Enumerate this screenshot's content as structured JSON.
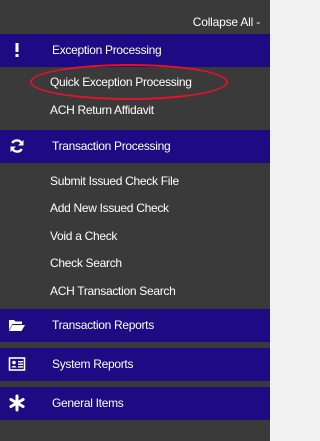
{
  "header": {
    "collapse_label": "Collapse All -"
  },
  "sections": [
    {
      "label": "Exception Processing",
      "icon": "exclamation-icon",
      "items": [
        {
          "label": "Quick Exception Processing"
        },
        {
          "label": "ACH Return Affidavit"
        }
      ]
    },
    {
      "label": "Transaction Processing",
      "icon": "refresh-icon",
      "items": [
        {
          "label": "Submit Issued Check File"
        },
        {
          "label": "Add New Issued Check"
        },
        {
          "label": "Void a Check"
        },
        {
          "label": "Check Search"
        },
        {
          "label": "ACH Transaction Search"
        }
      ]
    },
    {
      "label": "Transaction Reports",
      "icon": "folder-open-icon",
      "items": []
    },
    {
      "label": "System Reports",
      "icon": "id-card-icon",
      "items": []
    },
    {
      "label": "General Items",
      "icon": "asterisk-icon",
      "items": []
    }
  ],
  "colors": {
    "section_bg": "#1e0a82",
    "nav_bg": "#3a3a3a",
    "annotation_circle": "#e8102a"
  }
}
